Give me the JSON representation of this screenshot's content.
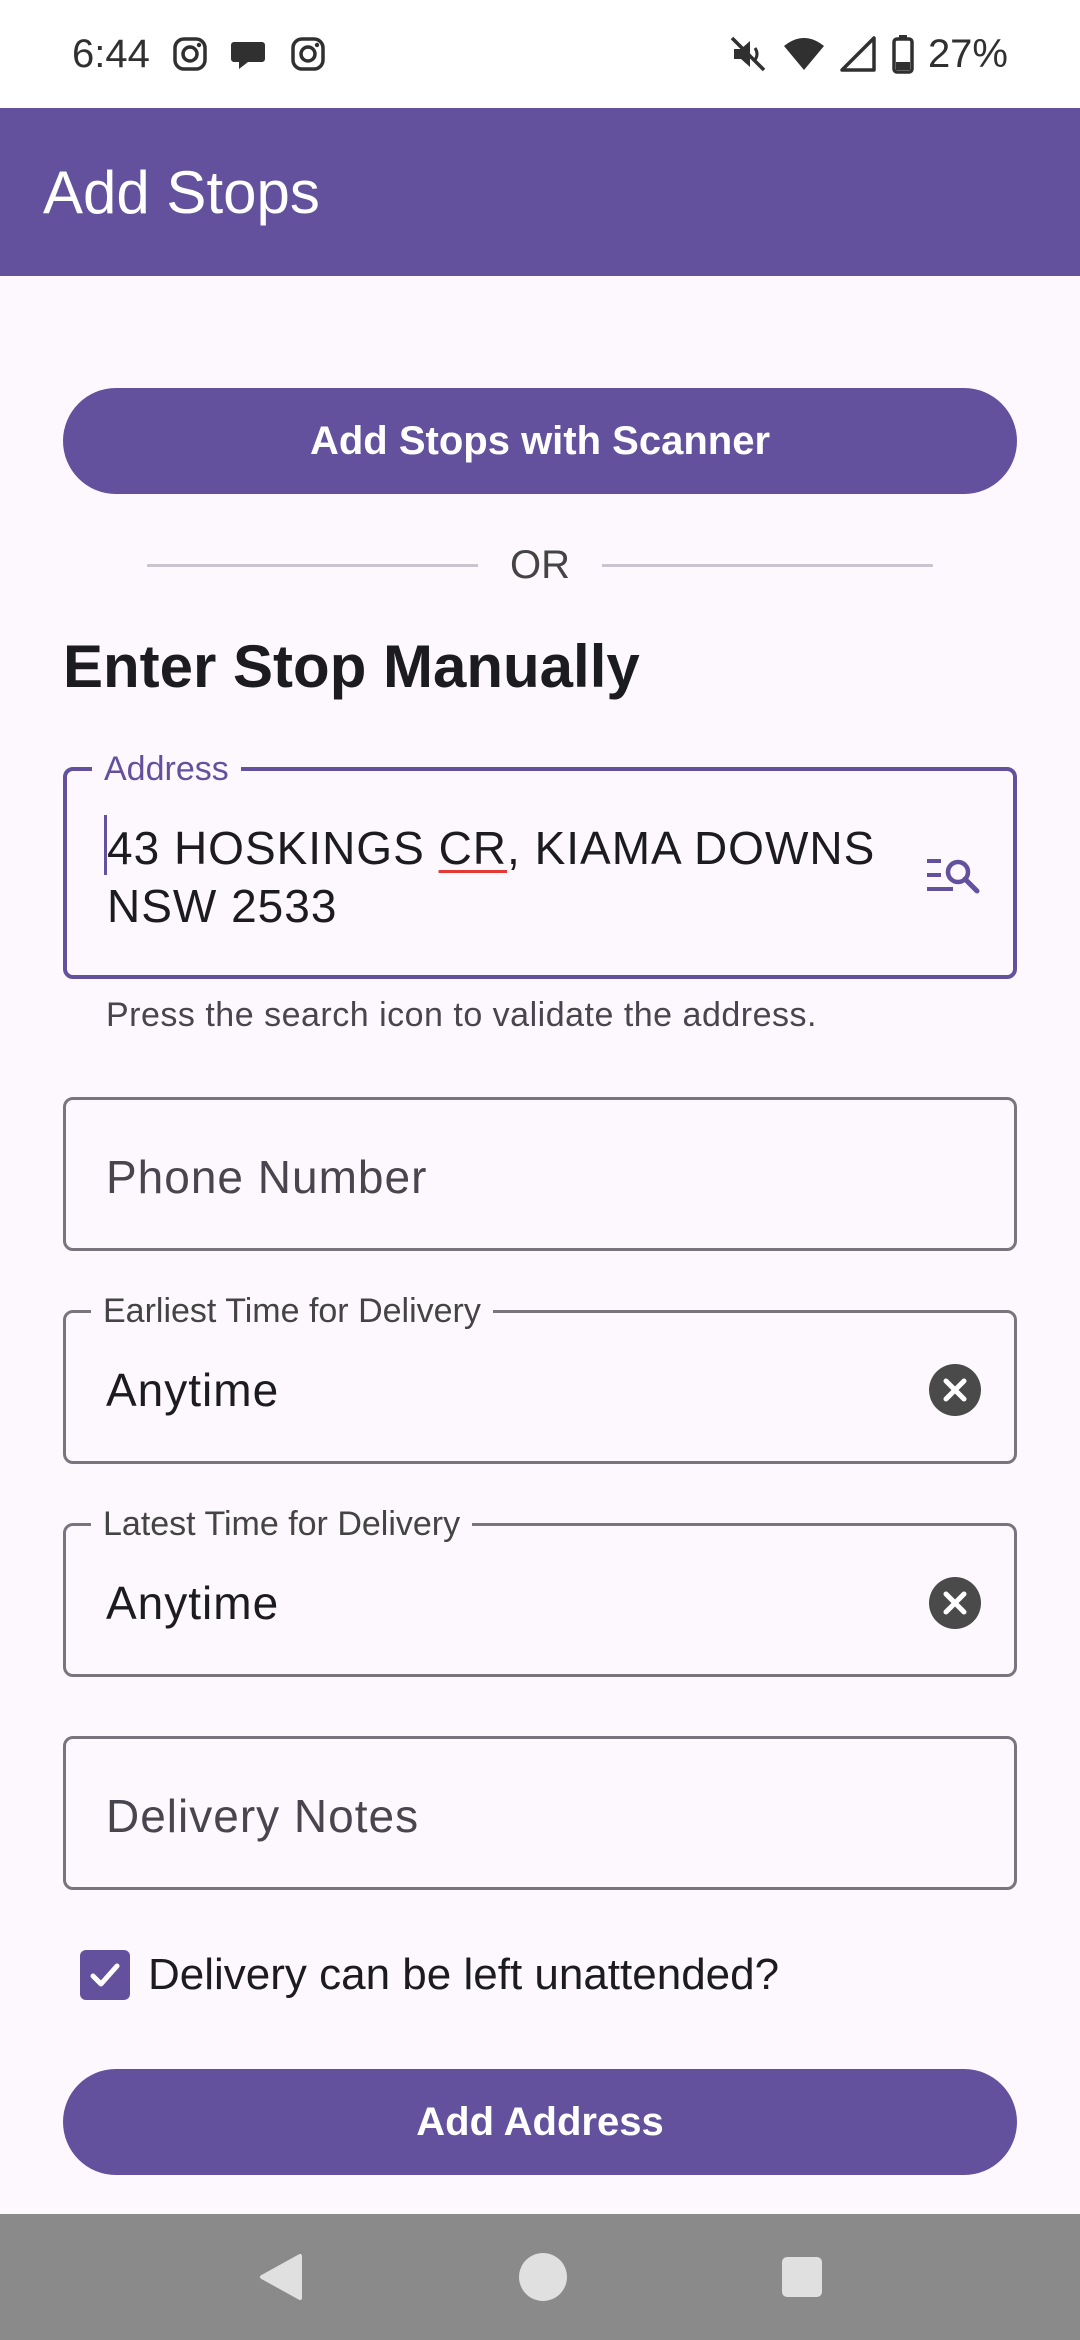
{
  "status_bar": {
    "time": "6:44",
    "notification_icons": [
      "instagram-icon",
      "chat-bubble-icon",
      "instagram-icon"
    ],
    "system_icons": [
      "mute-vibrate-icon",
      "wifi-icon",
      "cell-signal-icon",
      "battery-icon"
    ],
    "battery_percent": "27%"
  },
  "app_bar": {
    "title": "Add Stops"
  },
  "scanner_button": {
    "label": "Add Stops with Scanner"
  },
  "divider": {
    "label": "OR"
  },
  "section": {
    "title": "Enter Stop Manually"
  },
  "address_field": {
    "label": "Address",
    "value_line1_part1": "43 HOSKINGS ",
    "value_line1_misspelled": "CR",
    "value_line1_part2": ", KIAMA DOWNS",
    "value_line2": "NSW 2533",
    "trailing_icon": "search-list-icon",
    "helper": "Press the search icon to validate the address."
  },
  "phone_field": {
    "placeholder": "Phone Number"
  },
  "earliest_field": {
    "label": "Earliest Time for Delivery",
    "value": "Anytime",
    "trailing_icon": "clear-icon"
  },
  "latest_field": {
    "label": "Latest Time for Delivery",
    "value": "Anytime",
    "trailing_icon": "clear-icon"
  },
  "notes_field": {
    "placeholder": "Delivery Notes"
  },
  "unattended_checkbox": {
    "label": "Delivery can be left unattended?",
    "checked": true
  },
  "add_address_button": {
    "label": "Add Address"
  },
  "nav_bar": {
    "buttons": [
      "back-icon",
      "home-icon",
      "recents-icon"
    ]
  },
  "colors": {
    "primary": "#63519D",
    "background": "#FDF8FD",
    "outline": "#79747E",
    "error_underline": "#E53935"
  }
}
